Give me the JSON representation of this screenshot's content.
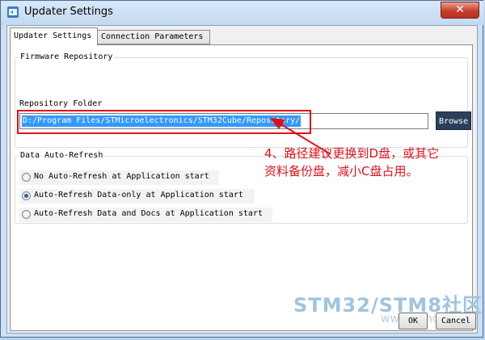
{
  "window": {
    "title": "Updater Settings",
    "close_label": "✕"
  },
  "tabs": [
    {
      "label": "Updater Settings",
      "active": true
    },
    {
      "label": "Connection Parameters",
      "active": false
    }
  ],
  "firmware_repository": {
    "legend": "Firmware Repository",
    "folder_label": "Repository Folder",
    "folder_value": "D:/Program Files/STMicroelectronics/STM32Cube/Repository/",
    "browse_label": "Browse"
  },
  "auto_refresh": {
    "legend": "Data Auto-Refresh",
    "options": [
      {
        "label": "No Auto-Refresh at Application start",
        "selected": false
      },
      {
        "label": "Auto-Refresh Data-only at Application start",
        "selected": true
      },
      {
        "label": "Auto-Refresh Data and Docs at Application start",
        "selected": false
      }
    ]
  },
  "annotation": {
    "line1": "4、路径建议更换到D盘，或其它",
    "line2": "资料备份盘，减小C盘占用。"
  },
  "watermark": {
    "main": "STM32/STM8社区",
    "sub": "www.stmcu.org"
  },
  "footer": {
    "ok_label": "OK",
    "cancel_label": "Cancel"
  },
  "colors": {
    "annotation_red": "#e0101a",
    "selection_blue": "#3399ff",
    "browse_bg": "#2a3f5a"
  }
}
